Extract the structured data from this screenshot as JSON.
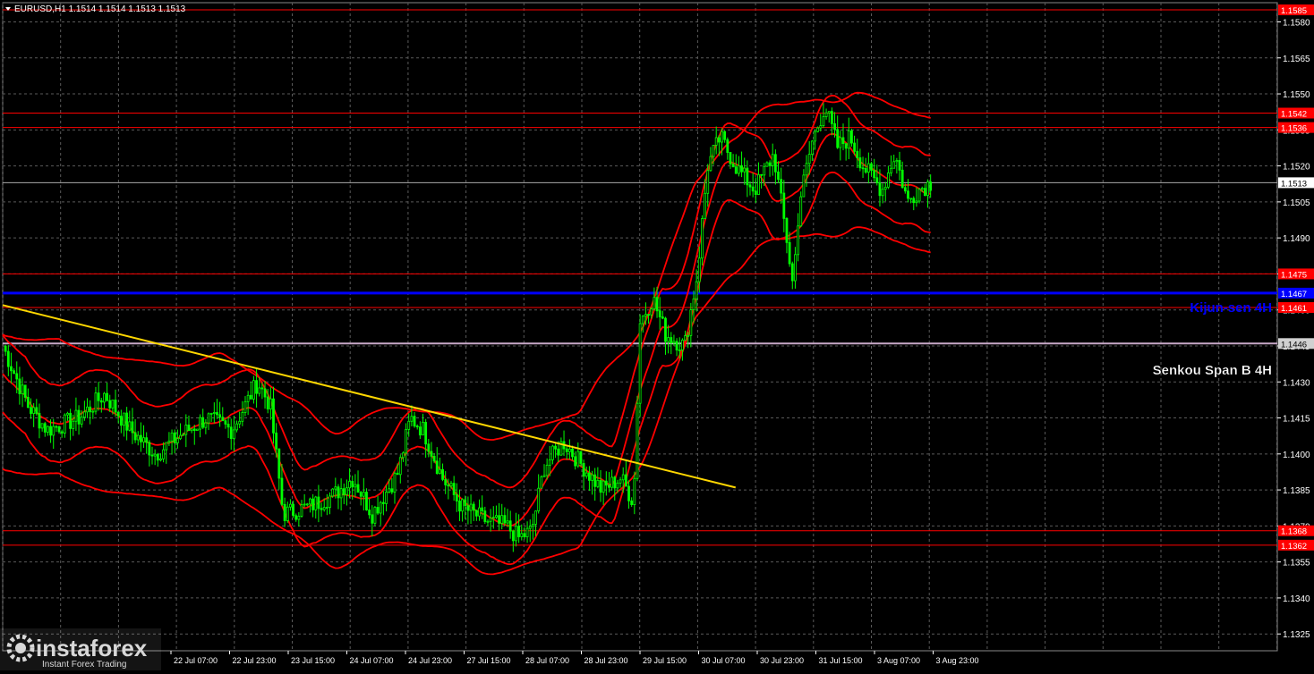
{
  "chart_data": {
    "type": "candlestick",
    "symbol_header": "EURUSD,H1  1.1514 1.1514 1.1513 1.1513",
    "ylim": [
      1.132,
      1.159
    ],
    "y_ticks": [
      "1.1580",
      "1.1565",
      "1.1550",
      "1.1535",
      "1.1520",
      "1.1505",
      "1.1490",
      "1.1475",
      "1.1460",
      "1.1445",
      "1.1430",
      "1.1415",
      "1.1400",
      "1.1385",
      "1.1370",
      "1.1355",
      "1.1340",
      "1.1325"
    ],
    "x_labels": [
      "22 Jul 07:00",
      "22 Jul 23:00",
      "23 Jul 15:00",
      "24 Jul 07:00",
      "24 Jul 23:00",
      "27 Jul 15:00",
      "28 Jul 07:00",
      "28 Jul 23:00",
      "29 Jul 15:00",
      "30 Jul 07:00",
      "30 Jul 23:00",
      "31 Jul 15:00",
      "3 Aug 07:00",
      "3 Aug 23:00"
    ],
    "grid": true,
    "horizontal_levels": [
      {
        "label": "1.1585",
        "value": 1.1585,
        "color": "#ff0000"
      },
      {
        "label": "1.1542",
        "value": 1.1542,
        "color": "#ff0000"
      },
      {
        "label": "1.1536",
        "value": 1.1536,
        "color": "#ff0000"
      },
      {
        "label": "1.1475",
        "value": 1.1475,
        "color": "#ff0000"
      },
      {
        "label": "1.1467",
        "value": 1.1467,
        "color": "#0000ff"
      },
      {
        "label": "1.1461",
        "value": 1.1461,
        "color": "#ff0000"
      },
      {
        "label": "1.1446",
        "value": 1.1446,
        "color": "#c8a8c8"
      },
      {
        "label": "1.1368",
        "value": 1.1368,
        "color": "#ff0000"
      },
      {
        "label": "1.1362",
        "value": 1.1362,
        "color": "#ff0000"
      }
    ],
    "current_price": {
      "label": "1.1513",
      "value": 1.1513
    },
    "annotations": [
      {
        "text": "Kijun-sen 4H",
        "color": "#0000ff"
      },
      {
        "text": "Senkou Span B 4H",
        "color": "#ffffff"
      }
    ],
    "trendline": {
      "start": [
        0,
        1.1462
      ],
      "end": [
        0.575,
        1.1386
      ],
      "color": "#ffd700"
    },
    "price_path": [
      [
        0.0,
        1.1445
      ],
      [
        0.02,
        1.142
      ],
      [
        0.035,
        1.141
      ],
      [
        0.06,
        1.1415
      ],
      [
        0.08,
        1.1425
      ],
      [
        0.1,
        1.141
      ],
      [
        0.12,
        1.14
      ],
      [
        0.14,
        1.1408
      ],
      [
        0.16,
        1.1415
      ],
      [
        0.18,
        1.141
      ],
      [
        0.2,
        1.143
      ],
      [
        0.21,
        1.142
      ],
      [
        0.22,
        1.1375
      ],
      [
        0.24,
        1.1378
      ],
      [
        0.26,
        1.1383
      ],
      [
        0.275,
        1.139
      ],
      [
        0.29,
        1.1375
      ],
      [
        0.31,
        1.1392
      ],
      [
        0.32,
        1.1415
      ],
      [
        0.33,
        1.141
      ],
      [
        0.345,
        1.139
      ],
      [
        0.36,
        1.1378
      ],
      [
        0.38,
        1.1372
      ],
      [
        0.395,
        1.137
      ],
      [
        0.405,
        1.1365
      ],
      [
        0.415,
        1.1368
      ],
      [
        0.425,
        1.1395
      ],
      [
        0.44,
        1.1405
      ],
      [
        0.455,
        1.1395
      ],
      [
        0.47,
        1.1385
      ],
      [
        0.485,
        1.139
      ],
      [
        0.495,
        1.138
      ],
      [
        0.5,
        1.1455
      ],
      [
        0.51,
        1.1465
      ],
      [
        0.52,
        1.145
      ],
      [
        0.535,
        1.1445
      ],
      [
        0.545,
        1.1475
      ],
      [
        0.553,
        1.152
      ],
      [
        0.563,
        1.1532
      ],
      [
        0.575,
        1.152
      ],
      [
        0.59,
        1.151
      ],
      [
        0.605,
        1.1525
      ],
      [
        0.615,
        1.149
      ],
      [
        0.62,
        1.147
      ],
      [
        0.625,
        1.1505
      ],
      [
        0.635,
        1.153
      ],
      [
        0.645,
        1.1545
      ],
      [
        0.655,
        1.1528
      ],
      [
        0.665,
        1.1532
      ],
      [
        0.675,
        1.152
      ],
      [
        0.69,
        1.151
      ],
      [
        0.7,
        1.1525
      ],
      [
        0.71,
        1.1505
      ],
      [
        0.718,
        1.151
      ],
      [
        0.728,
        1.1513
      ]
    ],
    "brand": {
      "logo": "instaforex",
      "tagline": "Instant Forex Trading"
    },
    "colors": {
      "background": "#000000",
      "grid": "#5a5a5a",
      "candles": "#00ff00",
      "bands": "#ff0000",
      "text": "#ffffff"
    }
  }
}
